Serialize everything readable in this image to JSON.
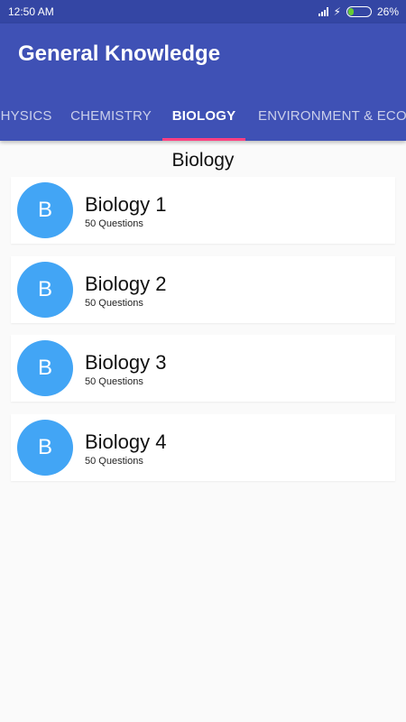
{
  "status": {
    "time": "12:50 AM",
    "battery_percent_text": "26%",
    "battery_level": 0.26,
    "icons": [
      "signal-icon",
      "charging-icon",
      "battery-icon"
    ]
  },
  "appbar": {
    "title": "General Knowledge",
    "color": "#3f51b5",
    "indicator_color": "#ff4081"
  },
  "tabs": [
    {
      "label": "Physics"
    },
    {
      "label": "Chemistry"
    },
    {
      "label": "Biology",
      "active": true
    },
    {
      "label": "Environment & Ecology"
    }
  ],
  "section_title": "Biology",
  "quizzes": [
    {
      "avatar": "B",
      "title": "Biology 1",
      "subtitle": "50 Questions"
    },
    {
      "avatar": "B",
      "title": "Biology 2",
      "subtitle": "50 Questions"
    },
    {
      "avatar": "B",
      "title": "Biology 3",
      "subtitle": "50 Questions"
    },
    {
      "avatar": "B",
      "title": "Biology 4",
      "subtitle": "50 Questions"
    }
  ],
  "avatar_color": "#42a5f5"
}
